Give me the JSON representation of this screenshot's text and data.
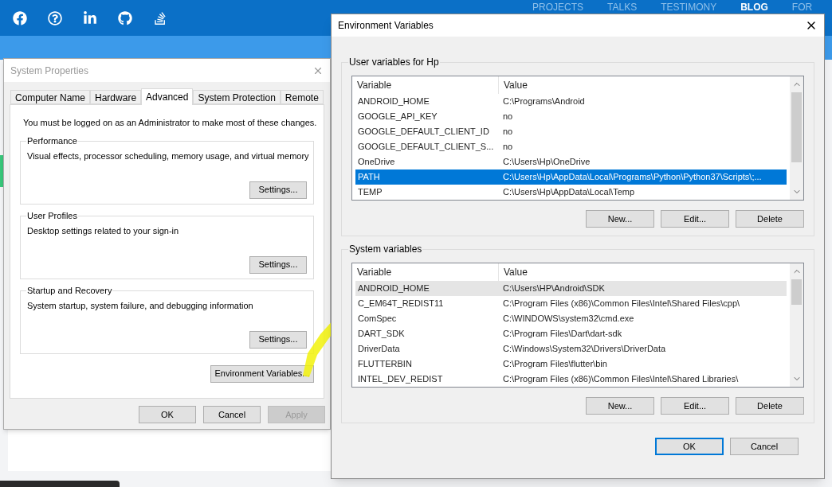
{
  "website": {
    "nav": [
      {
        "label": "PROJECTS",
        "selected": false
      },
      {
        "label": "TALKS",
        "selected": false
      },
      {
        "label": "TESTIMONY",
        "selected": false
      },
      {
        "label": "BLOG",
        "selected": true
      },
      {
        "label": "FOR",
        "selected": false
      }
    ]
  },
  "system_properties": {
    "title": "System Properties",
    "tabs": [
      {
        "label": "Computer Name",
        "selected": false
      },
      {
        "label": "Hardware",
        "selected": false
      },
      {
        "label": "Advanced",
        "selected": true
      },
      {
        "label": "System Protection",
        "selected": false
      },
      {
        "label": "Remote",
        "selected": false
      }
    ],
    "notice": "You must be logged on as an Administrator to make most of these changes.",
    "groups": [
      {
        "title": "Performance",
        "description": "Visual effects, processor scheduling, memory usage, and virtual memory",
        "button": "Settings..."
      },
      {
        "title": "User Profiles",
        "description": "Desktop settings related to your sign-in",
        "button": "Settings..."
      },
      {
        "title": "Startup and Recovery",
        "description": "System startup, system failure, and debugging information",
        "button": "Settings..."
      }
    ],
    "env_button": "Environment Variables...",
    "buttons": [
      {
        "label": "OK",
        "disabled": false
      },
      {
        "label": "Cancel",
        "disabled": false
      },
      {
        "label": "Apply",
        "disabled": true
      }
    ]
  },
  "environment_variables": {
    "title": "Environment Variables",
    "sections": [
      {
        "title": "User variables for Hp",
        "focused": true,
        "columns": [
          "Variable",
          "Value"
        ],
        "rows": [
          {
            "variable": "ANDROID_HOME",
            "value": "C:\\Programs\\Android",
            "selected": false
          },
          {
            "variable": "GOOGLE_API_KEY",
            "value": "no",
            "selected": false
          },
          {
            "variable": "GOOGLE_DEFAULT_CLIENT_ID",
            "value": "no",
            "selected": false
          },
          {
            "variable": "GOOGLE_DEFAULT_CLIENT_S...",
            "value": "no",
            "selected": false
          },
          {
            "variable": "OneDrive",
            "value": "C:\\Users\\Hp\\OneDrive",
            "selected": false
          },
          {
            "variable": "PATH",
            "value": "C:\\Users\\Hp\\AppData\\Local\\Programs\\Python\\Python37\\Scripts\\;...",
            "selected": true
          },
          {
            "variable": "TEMP",
            "value": "C:\\Users\\Hp\\AppData\\Local\\Temp",
            "selected": false
          }
        ],
        "buttons": [
          "New...",
          "Edit...",
          "Delete"
        ]
      },
      {
        "title": "System variables",
        "focused": false,
        "columns": [
          "Variable",
          "Value"
        ],
        "rows": [
          {
            "variable": "ANDROID_HOME",
            "value": "C:\\Users\\HP\\Android\\SDK",
            "selected": true
          },
          {
            "variable": "C_EM64T_REDIST11",
            "value": "C:\\Program Files (x86)\\Common Files\\Intel\\Shared Files\\cpp\\",
            "selected": false
          },
          {
            "variable": "ComSpec",
            "value": "C:\\WINDOWS\\system32\\cmd.exe",
            "selected": false
          },
          {
            "variable": "DART_SDK",
            "value": "C:\\Program Files\\Dart\\dart-sdk",
            "selected": false
          },
          {
            "variable": "DriverData",
            "value": "C:\\Windows\\System32\\Drivers\\DriverData",
            "selected": false
          },
          {
            "variable": "FLUTTERBIN",
            "value": "C:\\Program Files\\flutter\\bin",
            "selected": false
          },
          {
            "variable": "INTEL_DEV_REDIST",
            "value": "C:\\Program Files (x86)\\Common Files\\Intel\\Shared Libraries\\",
            "selected": false
          }
        ],
        "buttons": [
          "New...",
          "Edit...",
          "Delete"
        ]
      }
    ],
    "buttons": [
      {
        "label": "OK",
        "default": true
      },
      {
        "label": "Cancel",
        "default": false
      }
    ]
  }
}
